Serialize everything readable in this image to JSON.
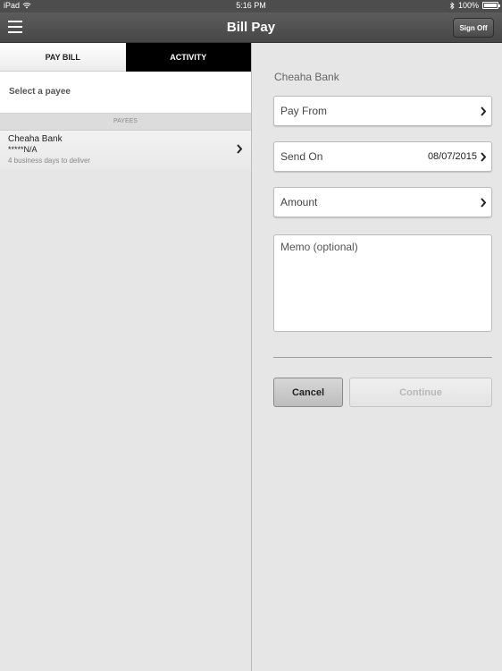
{
  "status_bar": {
    "device": "iPad",
    "time": "5:16 PM",
    "battery": "100%",
    "battery_level": 1.0
  },
  "nav": {
    "title": "Bill Pay",
    "sign_off": "Sign Off"
  },
  "tabs": [
    {
      "label": "PAY BILL",
      "active": true
    },
    {
      "label": "ACTIVITY",
      "active": false
    }
  ],
  "left": {
    "select_payee": "Select a payee",
    "payees_header": "PAYEES",
    "payees": [
      {
        "name": "Cheaha Bank",
        "account": "*****N/A",
        "delivery": "4 business days to deliver"
      }
    ]
  },
  "form": {
    "payee": "Cheaha Bank",
    "pay_from_label": "Pay From",
    "send_on_label": "Send On",
    "send_on_value": "08/07/2015",
    "amount_label": "Amount",
    "memo_placeholder": "Memo (optional)",
    "cancel_label": "Cancel",
    "continue_label": "Continue"
  }
}
